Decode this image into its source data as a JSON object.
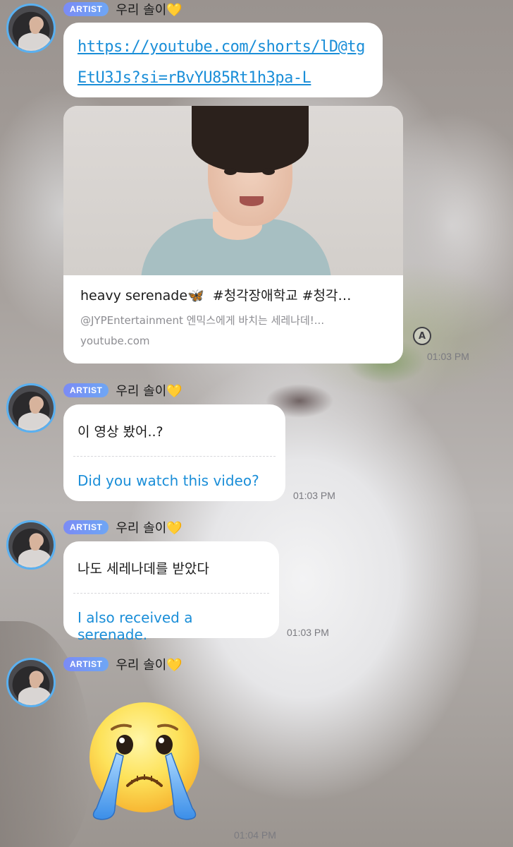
{
  "chat": {
    "messages": [
      {
        "badge": "ARTIST",
        "sender": "우리 솔이",
        "heart": "💛",
        "link": "https://youtube.com/shorts/lD@tgEtU3Js?si=rBvYU85Rt1h3pa-L",
        "preview": {
          "title": "heavy serenade",
          "butterfly": "🦋",
          "tags": "#청각장애학교 #청각…",
          "description": "@JYPEntertainment 엔믹스에게 바치는 세레나데!...",
          "domain": "youtube.com"
        },
        "time": "01:03 PM"
      },
      {
        "badge": "ARTIST",
        "sender": "우리 솔이",
        "heart": "💛",
        "original": "이 영상 봤어..?",
        "translation": "Did you watch this video?",
        "time": "01:03 PM"
      },
      {
        "badge": "ARTIST",
        "sender": "우리 솔이",
        "heart": "💛",
        "original": "나도 세레나데를 받았다",
        "translation": "I also received a serenade.",
        "time": "01:03 PM"
      },
      {
        "badge": "ARTIST",
        "sender": "우리 솔이",
        "heart": "💛",
        "sticker": "crying-face-emoji",
        "time": "01:04 PM"
      }
    ],
    "translate_icon_label": "A"
  },
  "colors": {
    "accent": "#1a8ed8",
    "badge": "#7b8bf5",
    "avatar_ring": "#5ab0f0"
  }
}
